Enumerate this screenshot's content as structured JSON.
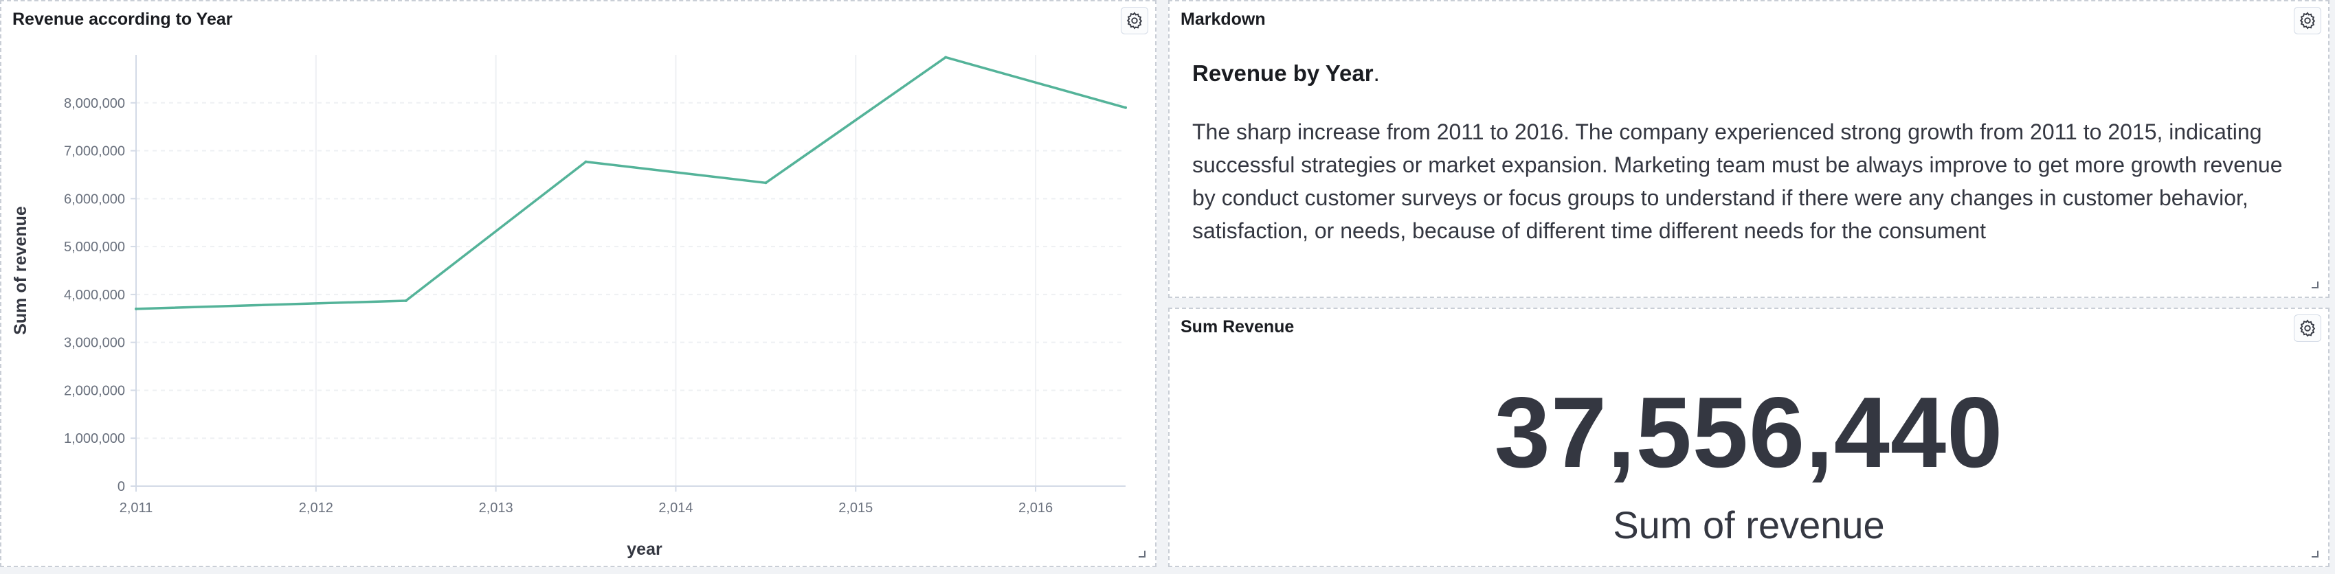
{
  "panels": {
    "revenue_chart": {
      "title": "Revenue according to Year"
    },
    "markdown": {
      "title": "Markdown",
      "heading": "Revenue by Year",
      "heading_suffix": ".",
      "body": "The sharp increase from 2011 to 2016. The company experienced strong growth from 2011 to 2015, indicating successful strategies or market expansion. Marketing team must be always improve to get more growth revenue by conduct customer surveys or focus groups to understand if there were any changes in customer behavior, satisfaction, or needs, because of different time different needs for the consument"
    },
    "sum_revenue": {
      "title": "Sum Revenue",
      "value": "37,556,440",
      "label": "Sum of revenue"
    }
  },
  "icons": [
    "gear-icon",
    "resize-handle-icon"
  ],
  "chart_data": {
    "type": "line",
    "title": "Revenue according to Year",
    "xlabel": "year",
    "ylabel": "Sum of revenue",
    "x": [
      2011,
      2012.5,
      2013.5,
      2014.5,
      2015.5,
      2016.5
    ],
    "series": [
      {
        "values": [
          3700000,
          3870000,
          6770000,
          6330000,
          8950000,
          7900000
        ],
        "color": "#54b399"
      }
    ],
    "xlim": [
      2011,
      2016.5
    ],
    "ylim": [
      0,
      9000000
    ],
    "xticks": [
      2011,
      2012,
      2013,
      2014,
      2015,
      2016
    ],
    "xtick_labels": [
      "2,011",
      "2,012",
      "2,013",
      "2,014",
      "2,015",
      "2,016"
    ],
    "yticks": [
      0,
      1000000,
      2000000,
      3000000,
      4000000,
      5000000,
      6000000,
      7000000,
      8000000
    ],
    "ytick_labels": [
      "0",
      "1,000,000",
      "2,000,000",
      "3,000,000",
      "4,000,000",
      "5,000,000",
      "6,000,000",
      "7,000,000",
      "8,000,000"
    ],
    "grid": true,
    "legend": "none"
  }
}
